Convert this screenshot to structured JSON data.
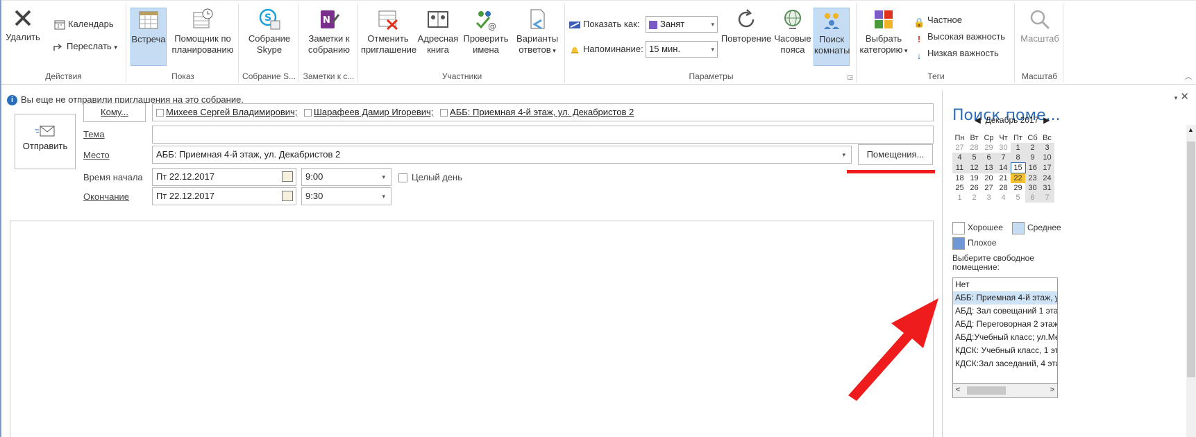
{
  "ribbon": {
    "actions": {
      "delete": "Удалить",
      "calendar": "Календарь",
      "forward": "Переслать",
      "group": "Действия"
    },
    "show": {
      "meeting": "Встреча",
      "scheduling_line1": "Помощник по",
      "scheduling_line2": "планированию",
      "group": "Показ"
    },
    "skype": {
      "line1": "Собрание",
      "line2": "Skype",
      "group": "Собрание S..."
    },
    "notes": {
      "line1": "Заметки к",
      "line2": "собранию",
      "group": "Заметки к с..."
    },
    "attendees": {
      "cancel_line1": "Отменить",
      "cancel_line2": "приглашение",
      "book_line1": "Адресная",
      "book_line2": "книга",
      "check_line1": "Проверить",
      "check_line2": "имена",
      "resp_line1": "Варианты",
      "resp_line2": "ответов",
      "group": "Участники"
    },
    "options": {
      "show_as": "Показать как:",
      "show_as_value": "Занят",
      "reminder": "Напоминание:",
      "reminder_value": "15 мин.",
      "recurrence": "Повторение",
      "tz_line1": "Часовые",
      "tz_line2": "пояса",
      "room_line1": "Поиск",
      "room_line2": "комнаты",
      "group": "Параметры"
    },
    "tags": {
      "categorize_line1": "Выбрать",
      "categorize_line2": "категорию",
      "private": "Частное",
      "high": "Высокая важность",
      "low": "Низкая важность",
      "group": "Теги"
    },
    "zoom": {
      "label": "Масштаб",
      "group": "Масштаб"
    }
  },
  "form": {
    "info": "Вы еще не отправили приглашения на это собрание.",
    "send": "Отправить",
    "to_button": "Кому...",
    "recipients": [
      "Михеев Сергей Владимирович;",
      "Шарафеев Дамир Игоревич;",
      "АББ: Приемная 4-й этаж, ул. Декабристов 2"
    ],
    "subject_label": "Тема",
    "subject_value": "",
    "location_label": "Место",
    "location_value": "АББ: Приемная 4-й этаж, ул. Декабристов 2",
    "rooms_button": "Помещения...",
    "start_label": "Время начала",
    "start_date": "Пт 22.12.2017",
    "start_time": "9:00",
    "allday": "Целый день",
    "end_label": "Окончание",
    "end_date": "Пт 22.12.2017",
    "end_time": "9:30"
  },
  "pane": {
    "title": "Поиск поме...",
    "month": "Декабрь 2017",
    "weekdays": [
      "Пн",
      "Вт",
      "Ср",
      "Чт",
      "Пт",
      "Сб",
      "Вс"
    ],
    "weeks": [
      [
        "27",
        "28",
        "29",
        "30",
        "1",
        "2",
        "3"
      ],
      [
        "4",
        "5",
        "6",
        "7",
        "8",
        "9",
        "10"
      ],
      [
        "11",
        "12",
        "13",
        "14",
        "15",
        "16",
        "17"
      ],
      [
        "18",
        "19",
        "20",
        "21",
        "22",
        "23",
        "24"
      ],
      [
        "25",
        "26",
        "27",
        "28",
        "29",
        "30",
        "31"
      ],
      [
        "1",
        "2",
        "3",
        "4",
        "5",
        "6",
        "7"
      ]
    ],
    "legend_good": "Хорошее",
    "legend_fair": "Среднее",
    "legend_poor": "Плохое",
    "choose_label": "Выберите свободное помещение:",
    "rooms": [
      "Нет",
      "АББ: Приемная 4-й этаж, ул",
      "АБД: Зал совещаний 1 эта:",
      "АБД: Переговорная 2 этаж",
      "АБД:Учебный класс; ул.Ме",
      "КДСК: Учебный класс, 1 эт",
      "КДСК:Зал заседаний, 4 эта:"
    ]
  },
  "colors": {
    "accent": "#2f6db5",
    "selected": "#c5dcf3",
    "today_busy": "#f4c233",
    "annotation": "#ee1c1c"
  }
}
